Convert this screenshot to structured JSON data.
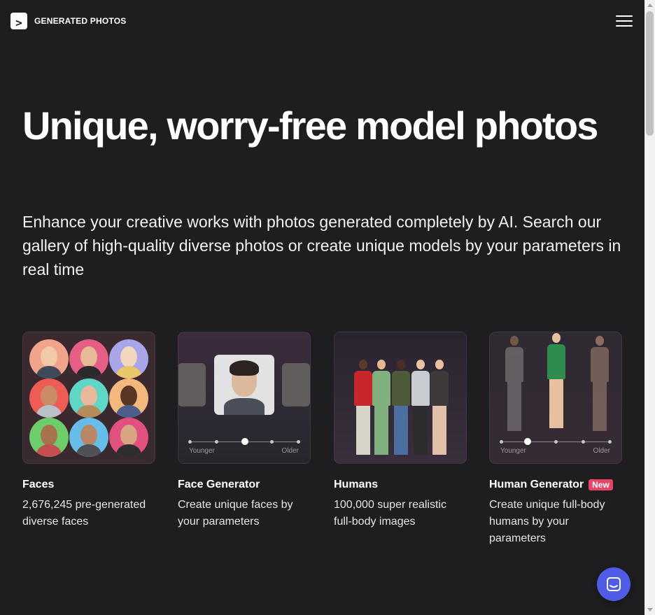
{
  "header": {
    "logo_mark": ">",
    "logo_text": "GENERATED PHOTOS",
    "menu_icon": "hamburger-menu-icon"
  },
  "hero": {
    "title": "Unique, worry-free model photos",
    "lead": "Enhance your creative works with photos generated completely by AI. Search our gallery of high-quality diverse photos or create unique models by your parameters in real time"
  },
  "cards": [
    {
      "title": "Faces",
      "badge": "",
      "description": "2,676,245 pre-generated diverse faces"
    },
    {
      "title": "Face Generator",
      "badge": "",
      "description": "Create unique faces by your parameters",
      "slider": {
        "left_label": "Younger",
        "right_label": "Older"
      }
    },
    {
      "title": "Humans",
      "badge": "",
      "description": "100,000 super realistic full-body images"
    },
    {
      "title": "Human Generator",
      "badge": "New",
      "description": "Create unique full-body humans by your parameters",
      "slider": {
        "left_label": "Younger",
        "right_label": "Older"
      }
    }
  ],
  "chat": {
    "icon": "chat-icon"
  },
  "colors": {
    "background": "#1e1e20",
    "badge": "#e54667",
    "chat_button": "#4f5ce6"
  }
}
